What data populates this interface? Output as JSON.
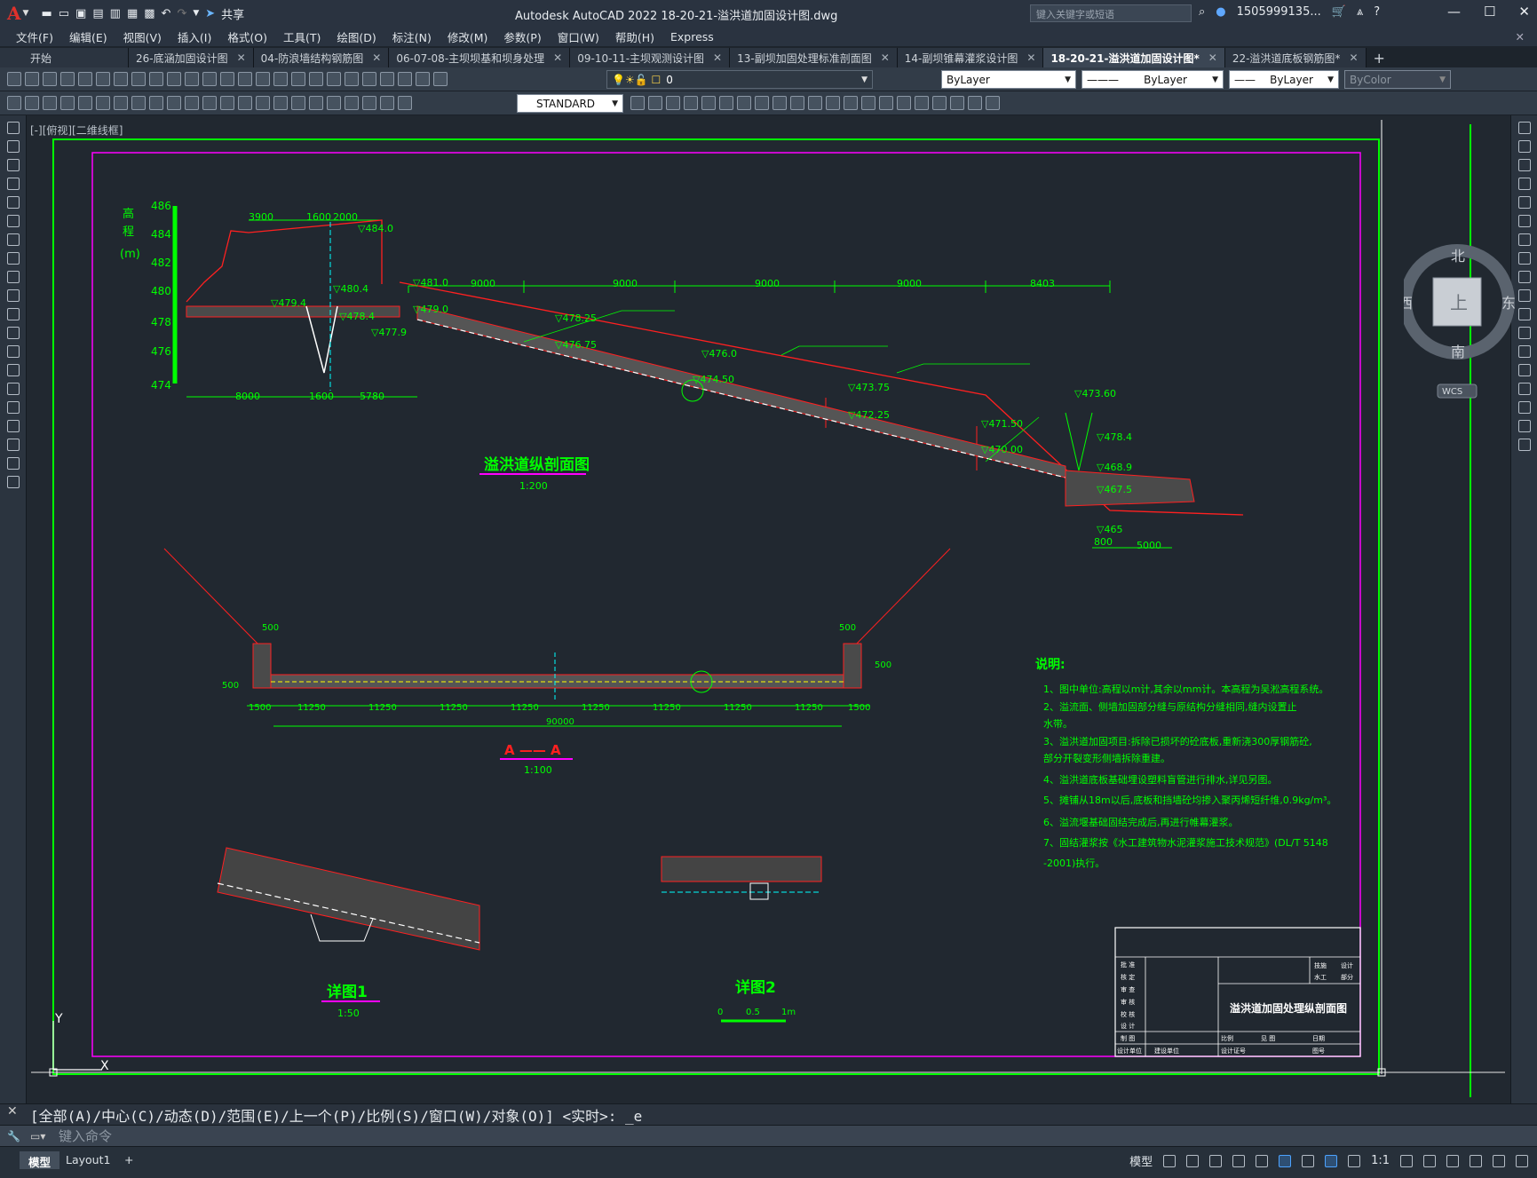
{
  "app": {
    "logo": "A",
    "window_title": "Autodesk AutoCAD 2022    18-20-21-溢洪道加固设计图.dwg",
    "share_label": "共享",
    "search_placeholder": "键入关键字或短语",
    "user": "1505999135...",
    "window_controls": [
      "—",
      "☐",
      "✕"
    ]
  },
  "menu": [
    "文件(F)",
    "编辑(E)",
    "视图(V)",
    "插入(I)",
    "格式(O)",
    "工具(T)",
    "绘图(D)",
    "标注(N)",
    "修改(M)",
    "参数(P)",
    "窗口(W)",
    "帮助(H)",
    "Express"
  ],
  "tabs": [
    {
      "label": "开始",
      "active": false
    },
    {
      "label": "26-底涵加固设计图",
      "active": false
    },
    {
      "label": "04-防浪墙结构钢筋图",
      "active": false
    },
    {
      "label": "06-07-08-主坝坝基和坝身处理",
      "active": false
    },
    {
      "label": "09-10-11-主坝观测设计图",
      "active": false
    },
    {
      "label": "13-副坝加固处理标准剖面图",
      "active": false
    },
    {
      "label": "14-副坝锥幕灌浆设计图",
      "active": false
    },
    {
      "label": "18-20-21-溢洪道加固设计图*",
      "active": true
    },
    {
      "label": "22-溢洪道底板钢筋图*",
      "active": false
    }
  ],
  "toolbar": {
    "layer_value": "0",
    "color_value": "ByLayer",
    "linetype_value": "ByLayer",
    "lineweight_value": "ByLayer",
    "plotstyle_value": "ByColor",
    "textstyle_value": "STANDARD"
  },
  "viewport_label": "[-][俯视][二维线框]",
  "viewcube": {
    "north": "北",
    "south": "南",
    "east": "东",
    "west": "西",
    "face": "上",
    "wcs": "WCS"
  },
  "drawing": {
    "profile_title": "溢洪道纵剖面图",
    "profile_scale": "1:200",
    "section_title": "A —— A",
    "section_scale": "1:100",
    "detail1_title": "详图1",
    "detail1_scale": "1:50",
    "detail2_title": "详图2",
    "detail2_scale_ticks": [
      "0",
      "0.5",
      "1m"
    ],
    "elev_axis_label": [
      "高",
      "程",
      "(m)"
    ],
    "elev_ticks": [
      "486",
      "484",
      "482",
      "480",
      "478",
      "476",
      "474"
    ],
    "top_dims": [
      "3900",
      "1600",
      "2000",
      "9000",
      "9000",
      "9000",
      "9000",
      "8403"
    ],
    "bottom_dims": [
      "8000",
      "1600",
      "5780",
      "800",
      "5000"
    ],
    "elev_marks": [
      "▽484.0",
      "▽481.0",
      "▽480.4",
      "▽479.4",
      "▽479.0",
      "▽478.4",
      "▽477.9",
      "▽478.25",
      "▽476.75",
      "▽476.0",
      "▽474.50",
      "▽473.75",
      "▽473.60",
      "▽472.25",
      "▽471.50",
      "▽470.00",
      "▽478.4",
      "▽468.9",
      "▽467.5",
      "▽465"
    ],
    "section_dims": [
      "1500",
      "11250",
      "11250",
      "11250",
      "11250",
      "11250",
      "11250",
      "11250",
      "11250",
      "1500",
      "90000"
    ],
    "section_side_dims": [
      "500",
      "500",
      "500",
      "500"
    ],
    "notes_title": "说明:",
    "notes": [
      "1、图中单位:高程以m计,其余以mm计。本高程为吴淞高程系统。",
      "2、溢流面、侧墙加固部分缝与原结构分缝相同,缝内设置止",
      "   水带。",
      "3、溢洪道加固项目:拆除已损坏的砼底板,重新浇300厚钢筋砼,",
      "   部分开裂变形侧墙拆除重建。",
      "4、溢洪道底板基础埋设塑料盲管进行排水,详见另图。",
      "5、摊铺从18m以后,底板和挡墙砼均掺入聚丙烯短纤维,0.9kg/m³。",
      "6、溢流堰基础固结完成后,再进行帷幕灌浆。",
      "7、固结灌浆按《水工建筑物水泥灌浆施工技术规范》(DL/T 5148",
      "   -2001)执行。"
    ],
    "title_block": {
      "drawing_name": "溢洪道加固处理纵剖面图",
      "rows": [
        "批 准",
        "核 定",
        "审 查",
        "审 核",
        "校 核",
        "设 计",
        "制 图",
        "设计单位"
      ],
      "right_top": [
        "技施",
        "设计",
        "水工",
        "部分"
      ],
      "bottom": [
        "建设单位",
        "比例",
        "设计证号",
        "见 图",
        "日期",
        "图号"
      ]
    }
  },
  "command": {
    "history": "[全部(A)/中心(C)/动态(D)/范围(E)/上一个(P)/比例(S)/窗口(W)/对象(O)] <实时>: _e",
    "input_placeholder": "键入命令"
  },
  "status": {
    "layout_tabs": [
      "模型",
      "Layout1",
      "+"
    ],
    "model_label": "模型",
    "scale": "1:1"
  }
}
